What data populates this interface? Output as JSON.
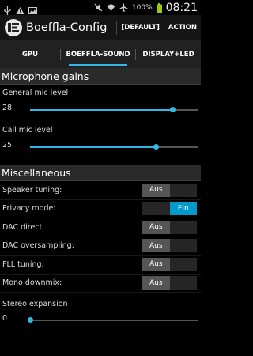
{
  "status_bar": {
    "battery": "100%",
    "time": "08:21"
  },
  "action_bar": {
    "title": "Boeffla-Config",
    "default_label": "[DEFAULT]",
    "action_label": "ACTION"
  },
  "tabs": [
    {
      "label": "GPU"
    },
    {
      "label": "BOEFFLA-SOUND"
    },
    {
      "label": "DISPLAY+LED"
    }
  ],
  "sections": {
    "mic": {
      "title": "Microphone gains",
      "general": {
        "label": "General mic level",
        "value": "28",
        "fraction": 0.85
      },
      "call": {
        "label": "Call mic level",
        "value": "25",
        "fraction": 0.75
      }
    },
    "misc": {
      "title": "Miscellaneous",
      "toggles": [
        {
          "label": "Speaker tuning:",
          "off": "Aus",
          "on": "",
          "state": "off"
        },
        {
          "label": "Privacy mode:",
          "off": "",
          "on": "Ein",
          "state": "on"
        },
        {
          "label": "DAC direct",
          "off": "Aus",
          "on": "",
          "state": "off"
        },
        {
          "label": "DAC oversampling:",
          "off": "Aus",
          "on": "",
          "state": "off"
        },
        {
          "label": "FLL tuning:",
          "off": "Aus",
          "on": "",
          "state": "off"
        },
        {
          "label": "Mono downmix:",
          "off": "Aus",
          "on": "",
          "state": "off"
        }
      ],
      "stereo": {
        "label": "Stereo expansion",
        "value": "0",
        "fraction": 0.0
      }
    }
  },
  "colors": {
    "accent": "#33b5e5",
    "toggle_on": "#0099cc",
    "toggle_off": "#555555"
  }
}
